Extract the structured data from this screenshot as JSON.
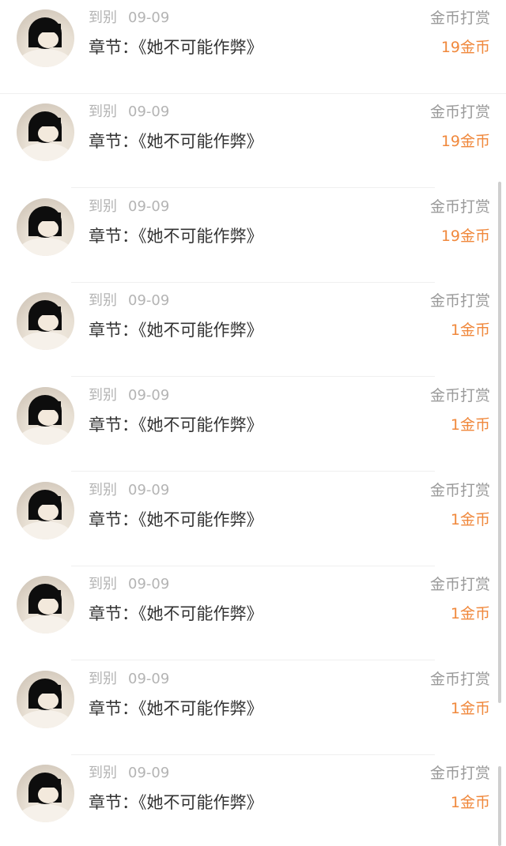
{
  "records": [
    {
      "user": "到别",
      "date": "09-09",
      "chapter": "章节：《她不可能作弊》",
      "reward_type": "金币打赏",
      "amount": "19金币"
    },
    {
      "user": "到别",
      "date": "09-09",
      "chapter": "章节：《她不可能作弊》",
      "reward_type": "金币打赏",
      "amount": "19金币"
    },
    {
      "user": "到别",
      "date": "09-09",
      "chapter": "章节：《她不可能作弊》",
      "reward_type": "金币打赏",
      "amount": "19金币"
    },
    {
      "user": "到别",
      "date": "09-09",
      "chapter": "章节：《她不可能作弊》",
      "reward_type": "金币打赏",
      "amount": "1金币"
    },
    {
      "user": "到别",
      "date": "09-09",
      "chapter": "章节：《她不可能作弊》",
      "reward_type": "金币打赏",
      "amount": "1金币"
    },
    {
      "user": "到别",
      "date": "09-09",
      "chapter": "章节：《她不可能作弊》",
      "reward_type": "金币打赏",
      "amount": "1金币"
    },
    {
      "user": "到别",
      "date": "09-09",
      "chapter": "章节：《她不可能作弊》",
      "reward_type": "金币打赏",
      "amount": "1金币"
    },
    {
      "user": "到别",
      "date": "09-09",
      "chapter": "章节：《她不可能作弊》",
      "reward_type": "金币打赏",
      "amount": "1金币"
    },
    {
      "user": "到别",
      "date": "09-09",
      "chapter": "章节：《她不可能作弊》",
      "reward_type": "金币打赏",
      "amount": "1金币"
    }
  ],
  "colors": {
    "amount": "#f0883c",
    "meta": "#b4b4b4",
    "chapter": "#333333",
    "reward_type": "#9a9a9a"
  },
  "icons": {
    "avatar": "user-avatar-image"
  }
}
